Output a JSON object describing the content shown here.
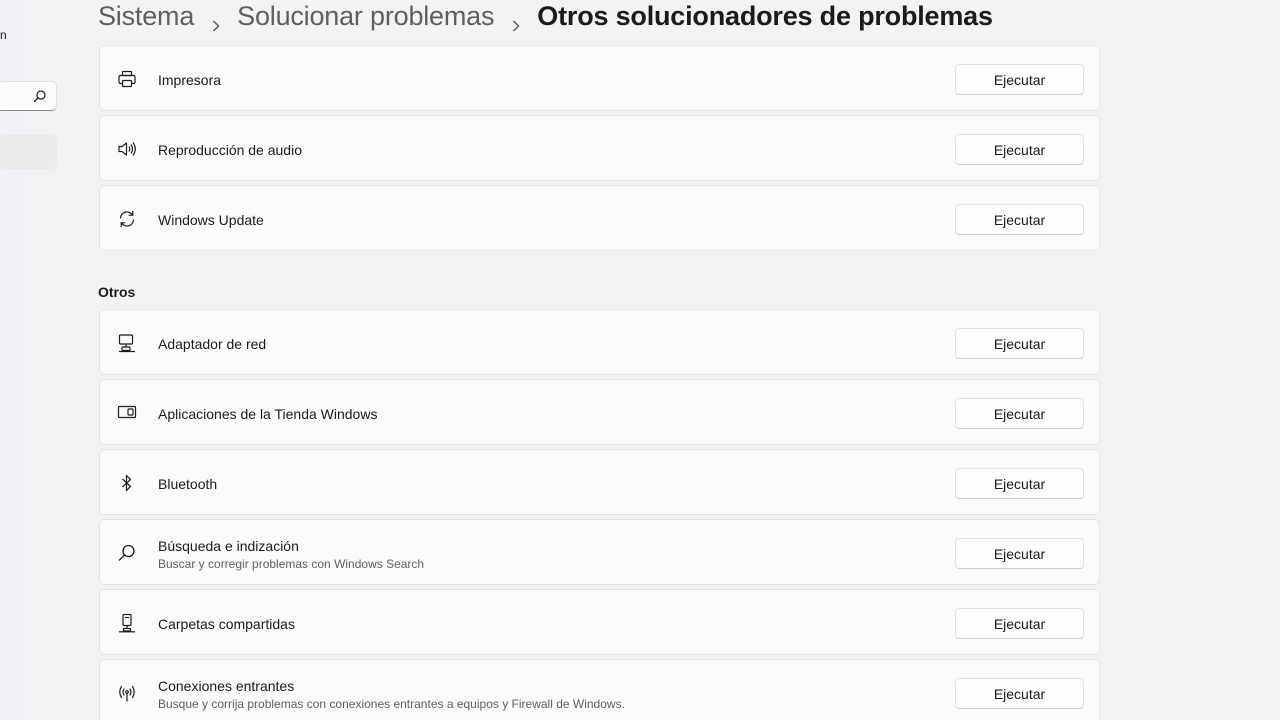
{
  "nav": {
    "fragment_letter": "n",
    "search_icon": "search-icon"
  },
  "breadcrumb": {
    "items": [
      "Sistema",
      "Solucionar problemas",
      "Otros solucionadores de problemas"
    ],
    "separator_icon": "chevron-right-icon"
  },
  "top_items": [
    {
      "icon": "printer-icon",
      "title": "Impresora",
      "button": "Ejecutar"
    },
    {
      "icon": "speaker-icon",
      "title": "Reproducción de audio",
      "button": "Ejecutar"
    },
    {
      "icon": "sync-icon",
      "title": "Windows Update",
      "button": "Ejecutar"
    }
  ],
  "others_section": {
    "header": "Otros",
    "items": [
      {
        "icon": "network-adapter-icon",
        "title": "Adaptador de red",
        "button": "Ejecutar"
      },
      {
        "icon": "store-apps-icon",
        "title": "Aplicaciones de la Tienda Windows",
        "button": "Ejecutar"
      },
      {
        "icon": "bluetooth-icon",
        "title": "Bluetooth",
        "button": "Ejecutar"
      },
      {
        "icon": "search-icon",
        "title": "Búsqueda e indización",
        "subtitle": "Buscar y corregir problemas con Windows Search",
        "button": "Ejecutar"
      },
      {
        "icon": "shared-folders-icon",
        "title": "Carpetas compartidas",
        "button": "Ejecutar"
      },
      {
        "icon": "antenna-icon",
        "title": "Conexiones entrantes",
        "subtitle": "Busque y corrija problemas con conexiones entrantes a equipos y Firewall de Windows.",
        "button": "Ejecutar"
      }
    ]
  },
  "colors": {
    "background": "#f3f3f3",
    "card": "#fbfbfb",
    "text_primary": "#1b1b1b",
    "text_secondary": "#5f5f5f"
  }
}
